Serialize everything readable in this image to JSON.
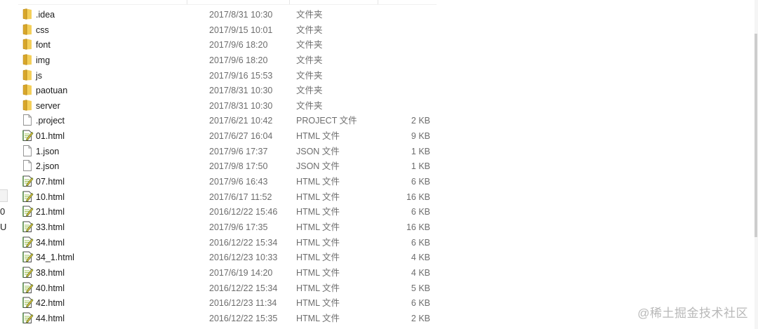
{
  "left_pane": {
    "partial_chars": [
      "0",
      "U"
    ]
  },
  "files": [
    {
      "name": ".idea",
      "date": "2017/8/31 10:30",
      "type": "文件夹",
      "size": "",
      "icon": "folder-icon"
    },
    {
      "name": "css",
      "date": "2017/9/15 10:01",
      "type": "文件夹",
      "size": "",
      "icon": "folder-icon"
    },
    {
      "name": "font",
      "date": "2017/9/6 18:20",
      "type": "文件夹",
      "size": "",
      "icon": "folder-icon"
    },
    {
      "name": "img",
      "date": "2017/9/6 18:20",
      "type": "文件夹",
      "size": "",
      "icon": "folder-icon"
    },
    {
      "name": "js",
      "date": "2017/9/16 15:53",
      "type": "文件夹",
      "size": "",
      "icon": "folder-icon"
    },
    {
      "name": "paotuan",
      "date": "2017/8/31 10:30",
      "type": "文件夹",
      "size": "",
      "icon": "folder-icon"
    },
    {
      "name": "server",
      "date": "2017/8/31 10:30",
      "type": "文件夹",
      "size": "",
      "icon": "folder-icon"
    },
    {
      "name": ".project",
      "date": "2017/6/21 10:42",
      "type": "PROJECT 文件",
      "size": "2 KB",
      "icon": "blank-file-icon"
    },
    {
      "name": "01.html",
      "date": "2017/6/27 16:04",
      "type": "HTML 文件",
      "size": "9 KB",
      "icon": "html-file-icon"
    },
    {
      "name": "1.json",
      "date": "2017/9/6 17:37",
      "type": "JSON 文件",
      "size": "1 KB",
      "icon": "blank-file-icon"
    },
    {
      "name": "2.json",
      "date": "2017/9/8 17:50",
      "type": "JSON 文件",
      "size": "1 KB",
      "icon": "blank-file-icon"
    },
    {
      "name": "07.html",
      "date": "2017/9/6 16:43",
      "type": "HTML 文件",
      "size": "6 KB",
      "icon": "html-file-icon"
    },
    {
      "name": "10.html",
      "date": "2017/6/17 11:52",
      "type": "HTML 文件",
      "size": "16 KB",
      "icon": "html-file-icon"
    },
    {
      "name": "21.html",
      "date": "2016/12/22 15:46",
      "type": "HTML 文件",
      "size": "6 KB",
      "icon": "html-file-icon"
    },
    {
      "name": "33.html",
      "date": "2017/9/6 17:35",
      "type": "HTML 文件",
      "size": "16 KB",
      "icon": "html-file-icon"
    },
    {
      "name": "34.html",
      "date": "2016/12/22 15:34",
      "type": "HTML 文件",
      "size": "6 KB",
      "icon": "html-file-icon"
    },
    {
      "name": "34_1.html",
      "date": "2016/12/23 10:33",
      "type": "HTML 文件",
      "size": "4 KB",
      "icon": "html-file-icon"
    },
    {
      "name": "38.html",
      "date": "2017/6/19 14:20",
      "type": "HTML 文件",
      "size": "4 KB",
      "icon": "html-file-icon"
    },
    {
      "name": "40.html",
      "date": "2016/12/22 15:34",
      "type": "HTML 文件",
      "size": "5 KB",
      "icon": "html-file-icon"
    },
    {
      "name": "42.html",
      "date": "2016/12/23 11:34",
      "type": "HTML 文件",
      "size": "6 KB",
      "icon": "html-file-icon"
    },
    {
      "name": "44.html",
      "date": "2016/12/22 15:35",
      "type": "HTML 文件",
      "size": "2 KB",
      "icon": "html-file-icon"
    }
  ],
  "watermark": "@稀土掘金技术社区"
}
